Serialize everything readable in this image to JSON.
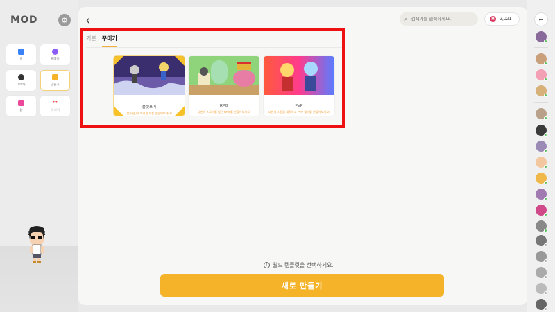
{
  "app": {
    "logo": "MOD"
  },
  "nav": [
    {
      "label": "홈",
      "color": "#3b82f6",
      "dim": false
    },
    {
      "label": "플레이",
      "color": "#8b5cf6",
      "dim": false
    },
    {
      "label": "아바타",
      "color": "#333333",
      "dim": false
    },
    {
      "label": "만들기",
      "color": "#f5b32a",
      "dim": false
    },
    {
      "label": "샵",
      "color": "#ec4899",
      "dim": false
    },
    {
      "label": "더 보기",
      "color": "#ef4444",
      "dim": true
    }
  ],
  "header": {
    "search_placeholder": "검색어를 입력하세요.",
    "coins": "2,021",
    "coin_symbol": "M"
  },
  "tabs": [
    {
      "label": "기본",
      "active": false
    },
    {
      "label": "꾸미기",
      "active": true
    }
  ],
  "templates": [
    {
      "title": "플랫포머",
      "desc": "점수(준)의 여정 월드를 만들어보세요!",
      "selected": true,
      "theme": "platformer"
    },
    {
      "title": "RPG",
      "desc": "나만의 스토리를 담은 RPG를 만들어보세요!",
      "selected": false,
      "theme": "rpg"
    },
    {
      "title": "PVP",
      "desc": "나만의 스킬을 제작하고 PVP 월드를 만들어보세요!",
      "selected": false,
      "theme": "pvp"
    }
  ],
  "footer": {
    "hint": "월드 템플릿을 선택하세요.",
    "create_label": "새로 만들기"
  },
  "friends": [
    {
      "status": "online"
    },
    {
      "status": "online"
    },
    {
      "status": "online"
    },
    {
      "status": "online"
    },
    {
      "status": "online"
    },
    {
      "status": "online"
    },
    {
      "status": "online"
    },
    {
      "status": "online"
    },
    {
      "status": "online"
    },
    {
      "status": "online"
    },
    {
      "status": "online"
    },
    {
      "status": "online"
    },
    {
      "status": "offline"
    },
    {
      "status": "offline"
    },
    {
      "status": "offline"
    },
    {
      "status": "offline"
    },
    {
      "status": "offline"
    }
  ],
  "colors": {
    "accent": "#f5b32a",
    "highlight": "#ee1111",
    "online": "#55c25a",
    "offline": "#aaaaaa"
  }
}
